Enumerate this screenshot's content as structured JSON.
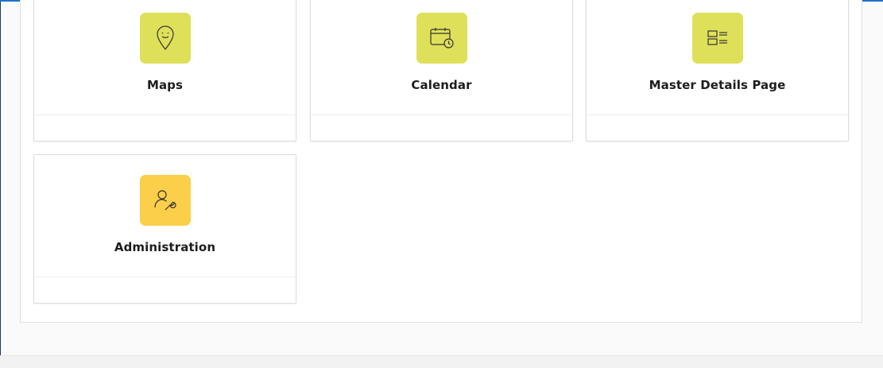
{
  "colors": {
    "accent_top": "#1a73c8",
    "tile_green": "#dfe05a",
    "tile_amber": "#fbcf4a"
  },
  "cards": [
    {
      "label": "Maps",
      "icon": "map-pin-icon",
      "tile_color": "#dfe05a"
    },
    {
      "label": "Calendar",
      "icon": "calendar-clock-icon",
      "tile_color": "#dfe05a"
    },
    {
      "label": "Master Details Page",
      "icon": "master-detail-icon",
      "tile_color": "#dfe05a"
    },
    {
      "label": "Administration",
      "icon": "user-settings-icon",
      "tile_color": "#fbcf4a"
    }
  ]
}
